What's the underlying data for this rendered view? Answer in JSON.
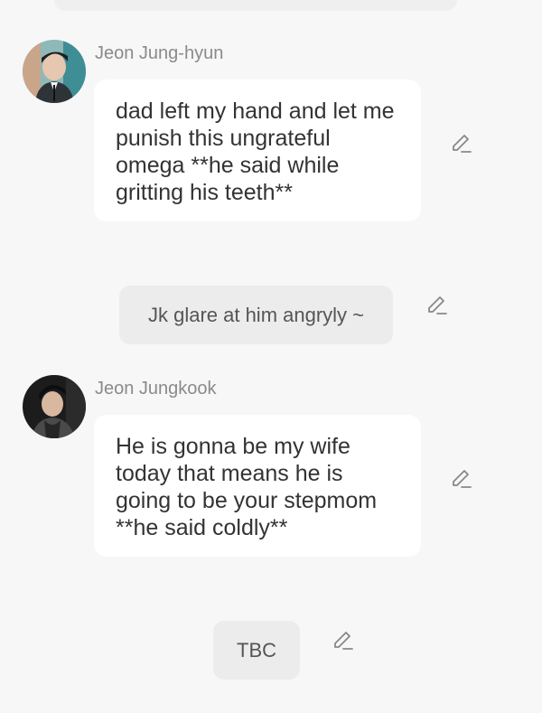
{
  "messages": [
    {
      "sender": "Jeon Jung-hyun",
      "text": "dad left my hand and let me punish this ungrateful omega **he said while gritting his teeth**"
    },
    {
      "sender": "Jeon Jungkook",
      "text": "He is gonna be my wife today that means he is going to be your stepmom **he said coldly**"
    }
  ],
  "narrations": [
    {
      "text": "Jk glare at him angryly ~"
    },
    {
      "text": "TBC"
    }
  ],
  "icons": {
    "edit": "pencil-edit-icon"
  },
  "colors": {
    "background": "#f7f7f7",
    "bubble": "#ffffff",
    "narration_bg": "#ececec",
    "name_text": "#8a8a8a",
    "message_text": "#333333"
  }
}
